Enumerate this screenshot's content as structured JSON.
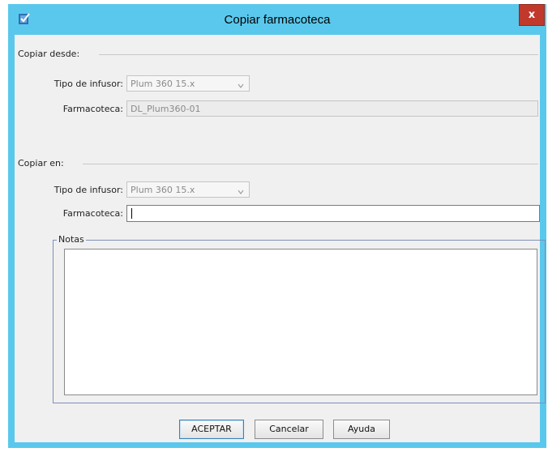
{
  "window": {
    "title": "Copiar farmacoteca",
    "close_label": "x",
    "app_icon": "checklist-app-icon",
    "border_color": "#5ac8ec",
    "close_color": "#c0392b"
  },
  "copy_from": {
    "section_label": "Copiar desde:",
    "infuser_type_label": "Tipo de infusor:",
    "infuser_type_value": "Plum 360 15.x",
    "library_label": "Farmacoteca:",
    "library_value": "DL_Plum360-01"
  },
  "copy_to": {
    "section_label": "Copiar en:",
    "infuser_type_label": "Tipo de infusor:",
    "infuser_type_value": "Plum 360 15.x",
    "library_label": "Farmacoteca:",
    "library_value": ""
  },
  "notes": {
    "group_label": "Notas",
    "value": ""
  },
  "buttons": {
    "accept": "ACEPTAR",
    "cancel": "Cancelar",
    "help": "Ayuda"
  }
}
